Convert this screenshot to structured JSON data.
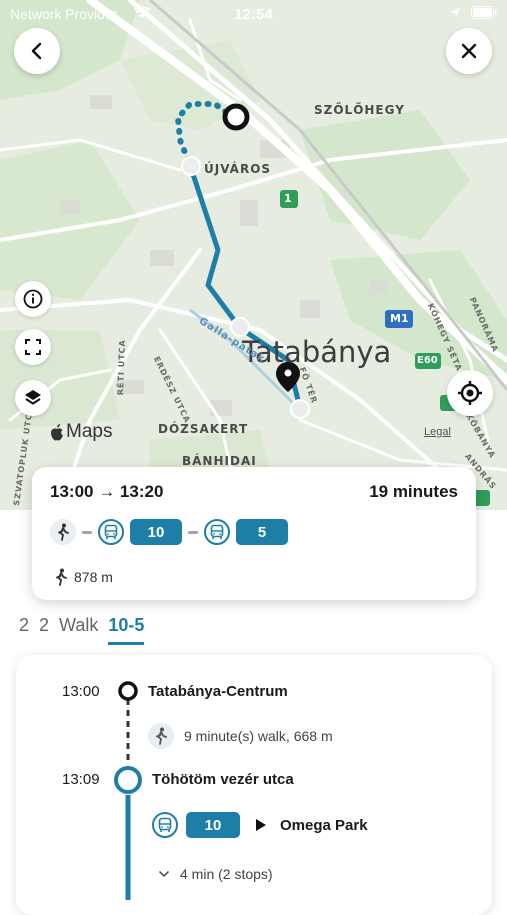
{
  "status_bar": {
    "carrier": "Network Provider",
    "time": "12:54"
  },
  "map": {
    "labels": {
      "szolohegy": "SZŐLŐHEGY",
      "ujvaros": "ÚJVÁROS",
      "city": "Tatabánya",
      "dozsakert": "DÓZSAKERT",
      "banhida": "BÁNHIDAI",
      "river": "Galla-patak",
      "erdesz": "ERDÉSZ UTCA",
      "reti": "RÉTI UTCA",
      "szatoplu": "SZVATOPLUK UTC",
      "foter": "FŐ TÉR",
      "kohegy": "KŐHEGY SÉTA",
      "panorama": "PANORÁMA",
      "kobanya": "KŐBÁNYA",
      "andras": "ANDRÁS",
      "road_1": "1",
      "road_m1": "M1",
      "road_e60": "E60"
    },
    "attribution": "Maps",
    "legal": "Legal"
  },
  "summary": {
    "time_range": "13:00 → 13:20",
    "duration": "19 minutes",
    "legs": [
      {
        "mode": "walk"
      },
      {
        "mode": "bus",
        "route": "10"
      },
      {
        "mode": "bus",
        "route": "5"
      }
    ],
    "walk_distance": "878 m"
  },
  "tabs": [
    {
      "label": "2",
      "active": false
    },
    {
      "label": "2",
      "active": false
    },
    {
      "label": "Walk",
      "active": false
    },
    {
      "label": "10-5",
      "active": true
    }
  ],
  "itinerary": {
    "stop1_time": "13:00",
    "stop1_name": "Tatabánya-Centrum",
    "walk_text": "9 minute(s) walk, 668 m",
    "stop2_time": "13:09",
    "stop2_name": "Töhötöm vezér utca",
    "bus_route": "10",
    "bus_direction": "Omega Park",
    "stops_text": "4 min (2 stops)"
  },
  "colors": {
    "accent": "#1d7fa8",
    "map_bg": "#e6ede0",
    "park": "#cfe3c8",
    "road": "#ffffff"
  }
}
